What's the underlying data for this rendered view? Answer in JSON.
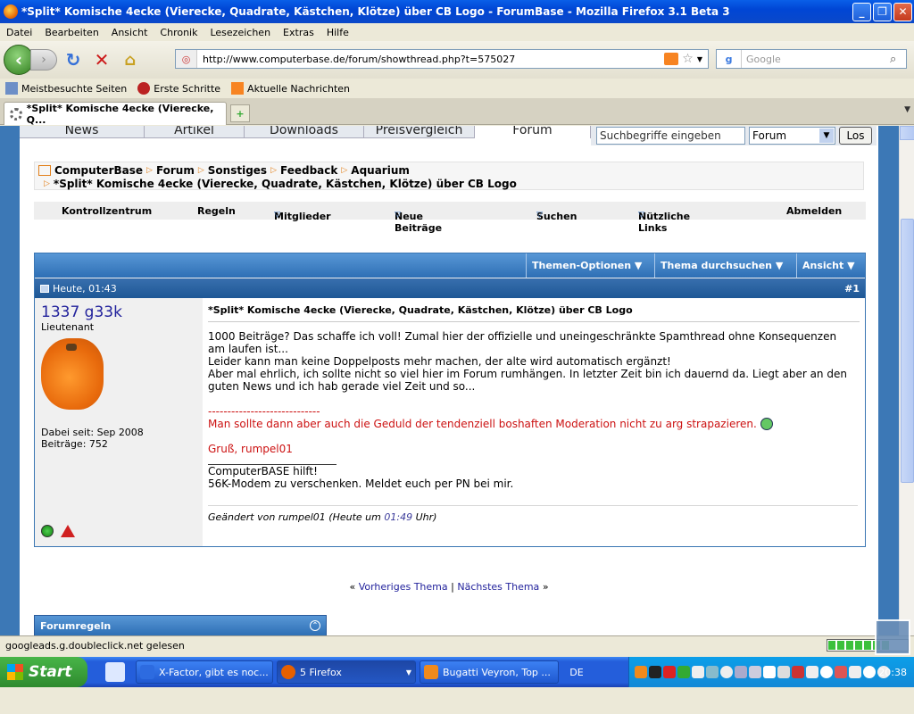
{
  "window": {
    "title": "*Split* Komische 4ecke (Vierecke, Quadrate, Kästchen, Klötze) über CB Logo - ForumBase - Mozilla Firefox 3.1 Beta 3"
  },
  "menubar": [
    "Datei",
    "Bearbeiten",
    "Ansicht",
    "Chronik",
    "Lesezeichen",
    "Extras",
    "Hilfe"
  ],
  "urlbar": {
    "url": "http://www.computerbase.de/forum/showthread.php?t=575027"
  },
  "searchbox": {
    "placeholder": "Google"
  },
  "bookmarks": [
    "Meistbesuchte Seiten",
    "Erste Schritte",
    "Aktuelle Nachrichten"
  ],
  "tab": {
    "title": "*Split* Komische 4ecke (Vierecke, Q..."
  },
  "site": {
    "navtabs": [
      "News",
      "Artikel",
      "Downloads",
      "Preisvergleich",
      "Forum"
    ],
    "search_input": "Suchbegriffe eingeben",
    "search_scope": "Forum",
    "search_button": "Los",
    "breadcrumb": [
      "ComputerBase",
      "Forum",
      "Sonstiges",
      "Feedback",
      "Aquarium"
    ],
    "thread_title": "*Split* Komische 4ecke (Vierecke, Quadrate, Kästchen, Klötze) über CB Logo",
    "controlbar": [
      "Kontrollzentrum",
      "Regeln",
      "Mitglieder",
      "Neue Beiträge",
      "Suchen",
      "Nützliche Links",
      "Abmelden"
    ],
    "options": [
      "Themen-Optionen",
      "Thema durchsuchen",
      "Ansicht"
    ]
  },
  "post": {
    "date": "Heute, 01:43",
    "number": "#1",
    "username": "1337 g33k",
    "usertitle": "Lieutenant",
    "joined": "Dabei seit: Sep 2008",
    "posts": "Beiträge: 752",
    "title": "*Split* Komische 4ecke (Vierecke, Quadrate, Kästchen, Klötze) über CB Logo",
    "body": [
      "1000 Beiträge? Das schaffe ich voll! Zumal hier der offizielle und uneingeschränkte Spamthread ohne Konsequenzen am laufen ist...",
      "Leider kann man keine Doppelposts mehr machen, der alte wird automatisch ergänzt!",
      "Aber mal ehrlich, ich sollte nicht so viel hier im Forum rumhängen. In letzter Zeit bin ich dauernd da. Liegt aber an den guten News und ich hab gerade viel Zeit und so..."
    ],
    "quote_sep": "-----------------------------",
    "quote": "Man sollte dann aber auch die Geduld der tendenziell boshaften Moderation nicht zu arg strapazieren.",
    "greeting": "Gruß, rumpel01",
    "signature": [
      "ComputerBASE hilft!",
      "56K-Modem zu verschenken. Meldet euch per PN bei mir."
    ],
    "edited_prefix": "Geändert von rumpel01 (Heute um",
    "edited_time": "01:49",
    "edited_suffix": "Uhr)"
  },
  "threadnav": {
    "prev": "Vorheriges Thema",
    "sep": "|",
    "next": "Nächstes Thema",
    "lq": "«",
    "rq": "»"
  },
  "forumrules": "Forumregeln",
  "statusbar": {
    "text": "googleads.g.doubleclick.net gelesen",
    "progress": 0.8
  },
  "taskbar": {
    "start": "Start",
    "tasks": [
      "X-Factor, gibt es noc...",
      "5 Firefox",
      "Bugatti Veyron, Top ..."
    ],
    "lang": "DE",
    "clock": "20:38"
  }
}
